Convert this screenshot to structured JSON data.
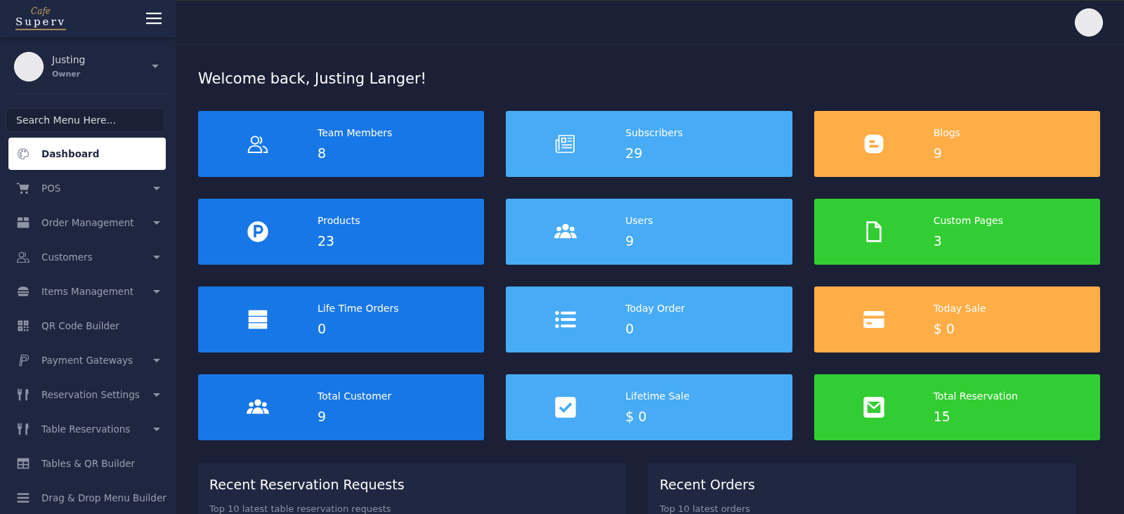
{
  "brand": {
    "script": "Cafe",
    "name": "Superv"
  },
  "user": {
    "name": "Justing",
    "role": "Owner"
  },
  "search": {
    "placeholder": "Search Menu Here..."
  },
  "menu": [
    {
      "label": "Dashboard",
      "kind": "palette",
      "dropdown": false,
      "selected": true
    },
    {
      "label": "POS",
      "kind": "cart",
      "dropdown": true,
      "selected": false
    },
    {
      "label": "Order Management",
      "kind": "box",
      "dropdown": true,
      "selected": false
    },
    {
      "label": "Customers",
      "kind": "users",
      "dropdown": true,
      "selected": false
    },
    {
      "label": "Items Management",
      "kind": "burger",
      "dropdown": true,
      "selected": false
    },
    {
      "label": "QR Code Builder",
      "kind": "qr",
      "dropdown": false,
      "selected": false
    },
    {
      "label": "Payment Gateways",
      "kind": "p",
      "dropdown": true,
      "selected": false
    },
    {
      "label": "Reservation Settings",
      "kind": "utensils",
      "dropdown": true,
      "selected": false
    },
    {
      "label": "Table Reservations",
      "kind": "utensils",
      "dropdown": true,
      "selected": false
    },
    {
      "label": "Tables & QR Builder",
      "kind": "table",
      "dropdown": false,
      "selected": false
    },
    {
      "label": "Drag & Drop Menu Builder",
      "kind": "bars",
      "selected": false
    }
  ],
  "welcome": "Welcome back, Justing Langer!",
  "cards": [
    {
      "label": "Team Members",
      "value": "8",
      "kind": "users",
      "color": "#1877e6"
    },
    {
      "label": "Subscribers",
      "value": "29",
      "kind": "newspaper",
      "color": "#47abf5"
    },
    {
      "label": "Blogs",
      "value": "9",
      "kind": "blog",
      "color": "#ffad46"
    },
    {
      "label": "Products",
      "value": "23",
      "kind": "p",
      "color": "#1877e6"
    },
    {
      "label": "Users",
      "value": "9",
      "kind": "group",
      "color": "#47abf5"
    },
    {
      "label": "Custom Pages",
      "value": "3",
      "kind": "file",
      "color": "#32cd32"
    },
    {
      "label": "Life Time Orders",
      "value": "0",
      "kind": "server",
      "color": "#1877e6"
    },
    {
      "label": "Today Order",
      "value": "0",
      "kind": "list",
      "color": "#47abf5"
    },
    {
      "label": "Today Sale",
      "value": "$ 0",
      "kind": "card",
      "color": "#ffad46"
    },
    {
      "label": "Total Customer",
      "value": "9",
      "kind": "group",
      "color": "#1877e6"
    },
    {
      "label": "Lifetime Sale",
      "value": "$ 0",
      "kind": "check",
      "color": "#47abf5"
    },
    {
      "label": "Total Reservation",
      "value": "15",
      "kind": "mail",
      "color": "#32cd32"
    }
  ],
  "panels": [
    {
      "title": "Recent Reservation Requests",
      "subtitle": "Top 10 latest table reservation requests"
    },
    {
      "title": "Recent Orders",
      "subtitle": "Top 10 latest orders"
    }
  ]
}
